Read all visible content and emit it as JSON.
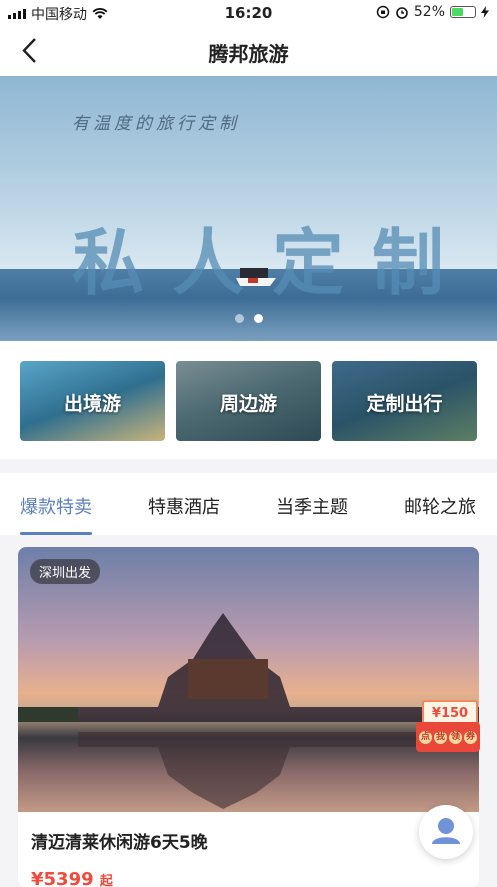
{
  "status": {
    "carrier": "中国移动",
    "time": "16:20",
    "battery": "52%",
    "battery_level": 0.52
  },
  "navbar": {
    "title": "腾邦旅游"
  },
  "banner": {
    "slogan": "有温度的旅行定制",
    "title": "私人定制",
    "slide_count": 2,
    "active_slide": 1
  },
  "categories": [
    {
      "label": "出境游"
    },
    {
      "label": "周边游"
    },
    {
      "label": "定制出行"
    }
  ],
  "tabs": [
    {
      "label": "爆款特卖",
      "active": true
    },
    {
      "label": "特惠酒店",
      "active": false
    },
    {
      "label": "当季主题",
      "active": false
    },
    {
      "label": "邮轮之旅",
      "active": false
    }
  ],
  "product": {
    "badge": "深圳出发",
    "name": "清迈清莱休闲游6天5晚",
    "price": "¥5399",
    "price_suffix": "起"
  },
  "coupon": {
    "amount": "¥150",
    "chars": [
      "点",
      "我",
      "领",
      "券"
    ]
  },
  "colors": {
    "accent": "#5b7fbf",
    "price": "#f04a3c"
  }
}
